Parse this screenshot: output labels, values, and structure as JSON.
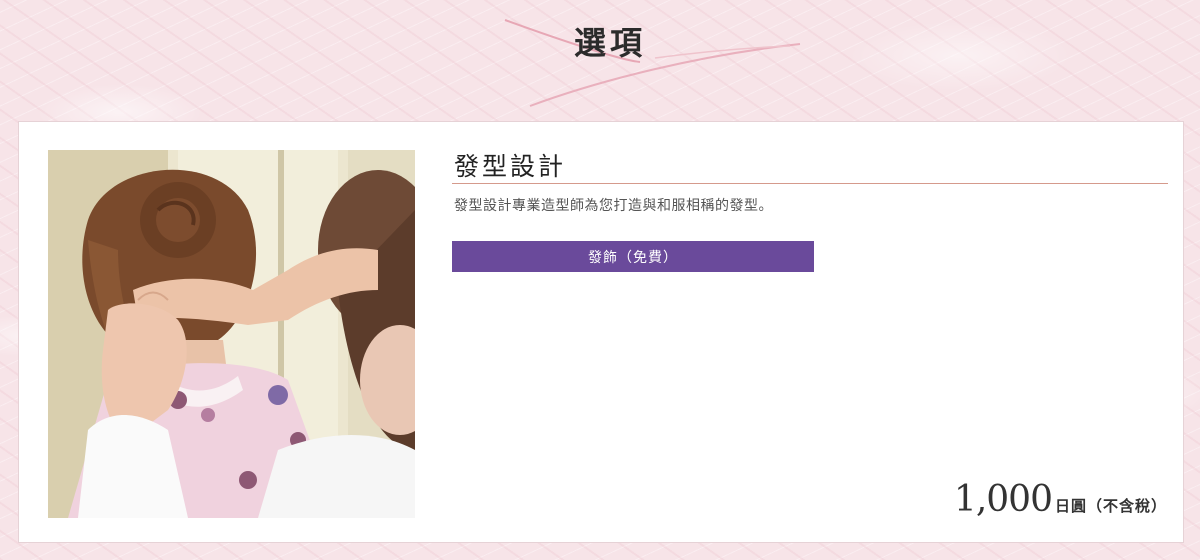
{
  "section": {
    "title": "選項"
  },
  "option": {
    "title": "發型設計",
    "description": "發型設計專業造型師為您打造與和服相稱的發型。",
    "accessory_button": "發飾（免費）",
    "price_amount": "1,000",
    "price_unit": "日圓（不含稅）"
  },
  "colors": {
    "background": "#f7e4e8",
    "accent_button": "#6a4a9b",
    "title_rule": "#d59a8c",
    "deco_swoosh": "#e7a7b5"
  },
  "images": {
    "photo": "hairstyling-photo"
  }
}
